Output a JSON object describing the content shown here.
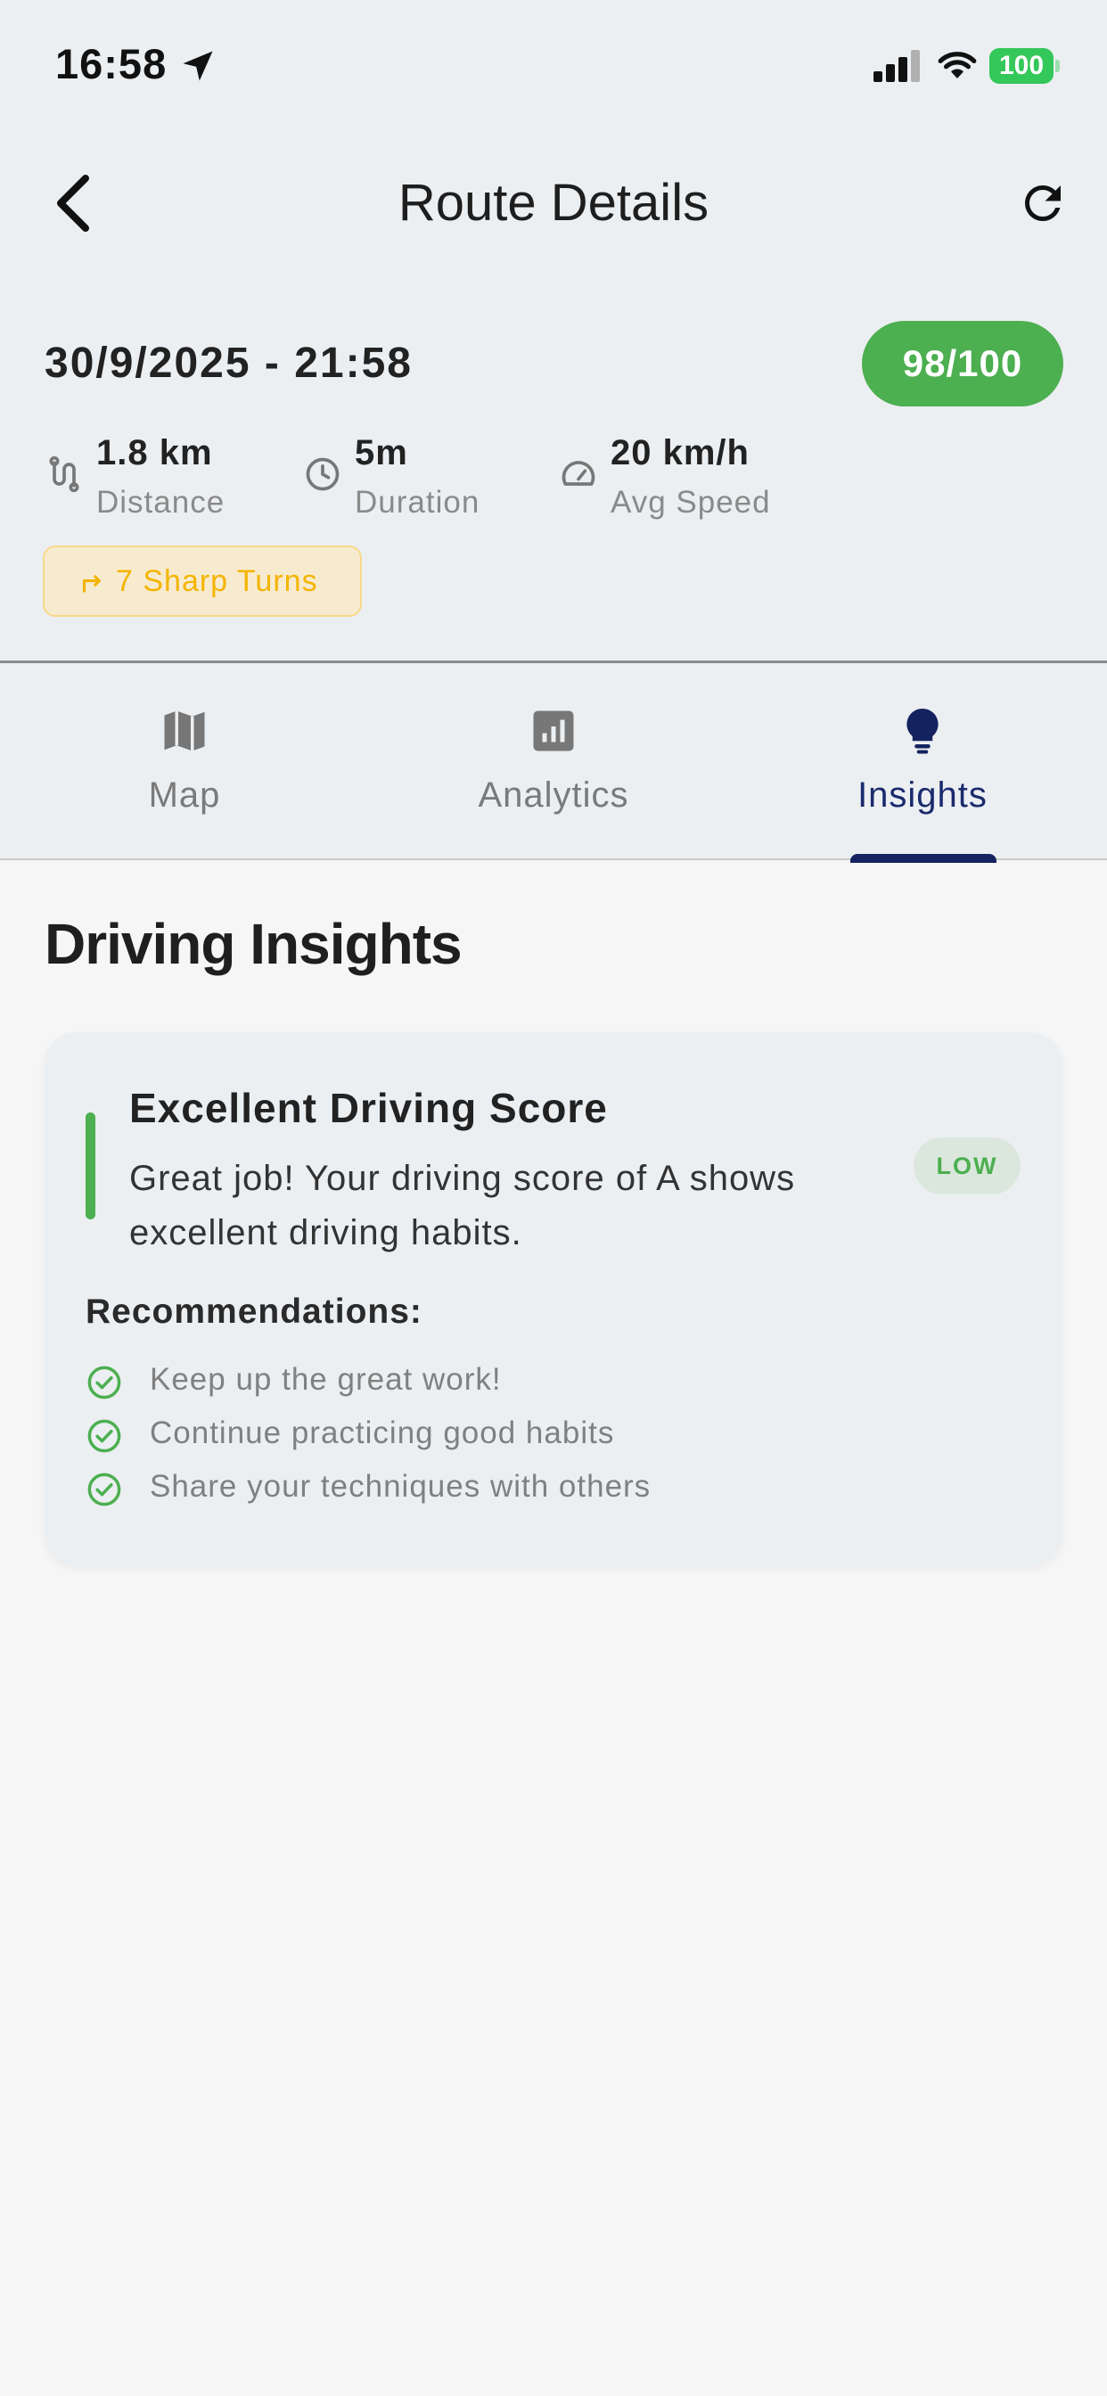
{
  "status_bar": {
    "time": "16:58",
    "battery": "100",
    "icons": [
      "location-arrow-icon",
      "cellular-signal-icon",
      "wifi-icon",
      "battery-icon"
    ]
  },
  "header": {
    "title": "Route Details",
    "back_icon": "chevron-left-icon",
    "refresh_icon": "refresh-icon"
  },
  "route": {
    "datetime": "30/9/2025 - 21:58",
    "score": "98/100",
    "stats": {
      "distance": {
        "value": "1.8 km",
        "label": "Distance",
        "icon": "route-icon"
      },
      "duration": {
        "value": "5m",
        "label": "Duration",
        "icon": "clock-icon"
      },
      "avg_speed": {
        "value": "20 km/h",
        "label": "Avg Speed",
        "icon": "speedometer-icon"
      }
    },
    "alert_chip": {
      "label": "7 Sharp Turns",
      "icon": "turn-right-icon"
    }
  },
  "tabs": [
    {
      "label": "Map",
      "icon": "map-icon",
      "active": false
    },
    {
      "label": "Analytics",
      "icon": "analytics-icon",
      "active": false
    },
    {
      "label": "Insights",
      "icon": "lightbulb-icon",
      "active": true
    }
  ],
  "insights": {
    "section_title": "Driving Insights",
    "card": {
      "title": "Excellent Driving Score",
      "description": "Great job! Your driving score of A shows excellent driving habits.",
      "severity": "LOW",
      "recommendations_title": "Recommendations:",
      "recommendations": [
        "Keep up the great work!",
        "Continue practicing good habits",
        "Share your techniques with others"
      ]
    }
  },
  "colors": {
    "score_green": "#4caf50",
    "active_tab": "#14235f",
    "warning_yellow": "#f4b400",
    "header_bg": "#eceff2",
    "page_bg": "#f6f6f6"
  }
}
